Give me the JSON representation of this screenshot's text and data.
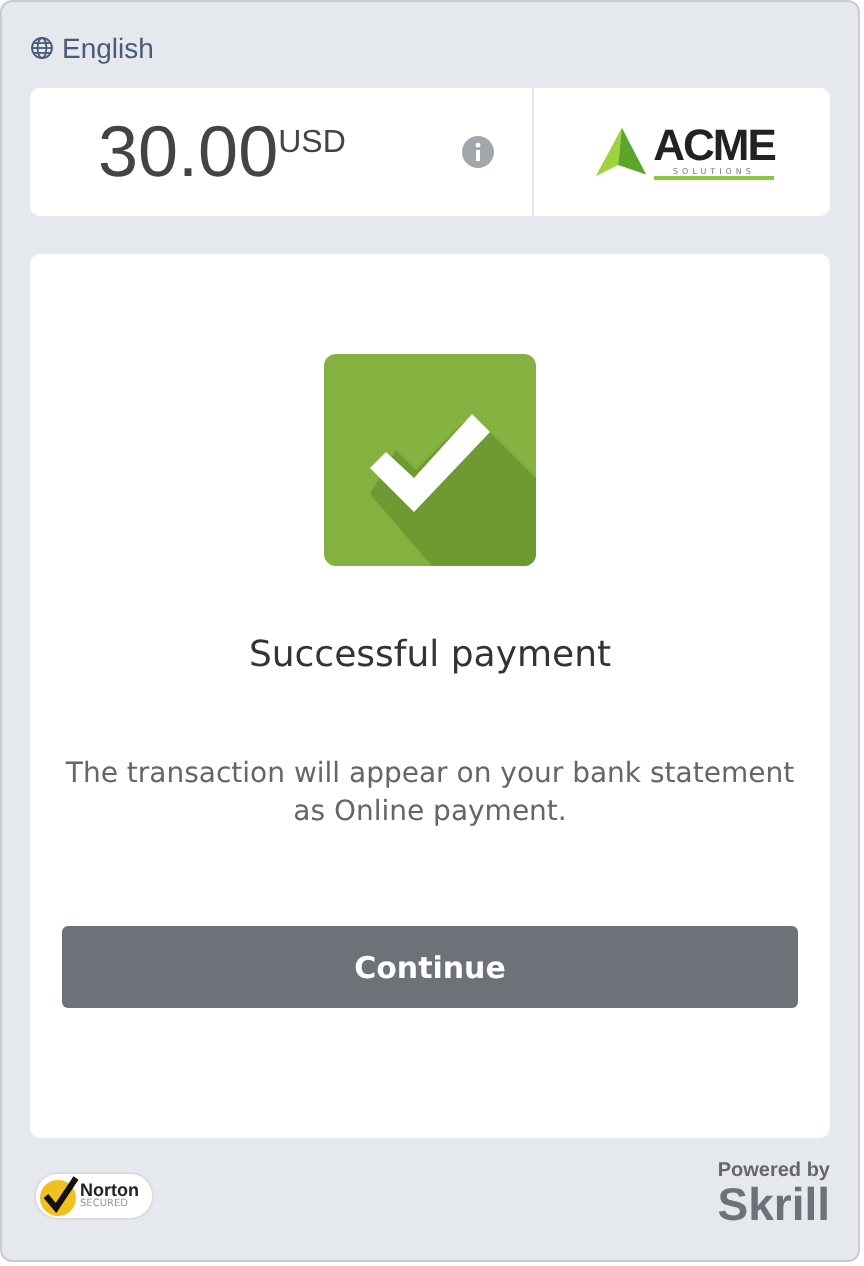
{
  "language": {
    "label": "English"
  },
  "summary": {
    "amount": "30.00",
    "currency": "USD",
    "merchant_logo": {
      "name": "ACME",
      "tagline": "SOLUTIONS"
    }
  },
  "result": {
    "title": "Successful payment",
    "message": "The transaction will appear on your bank statement as Online payment.",
    "button": "Continue"
  },
  "footer": {
    "badge": {
      "name": "Norton",
      "sub": "SECURED"
    },
    "powered_by": "Powered by",
    "brand": "Skrill"
  }
}
